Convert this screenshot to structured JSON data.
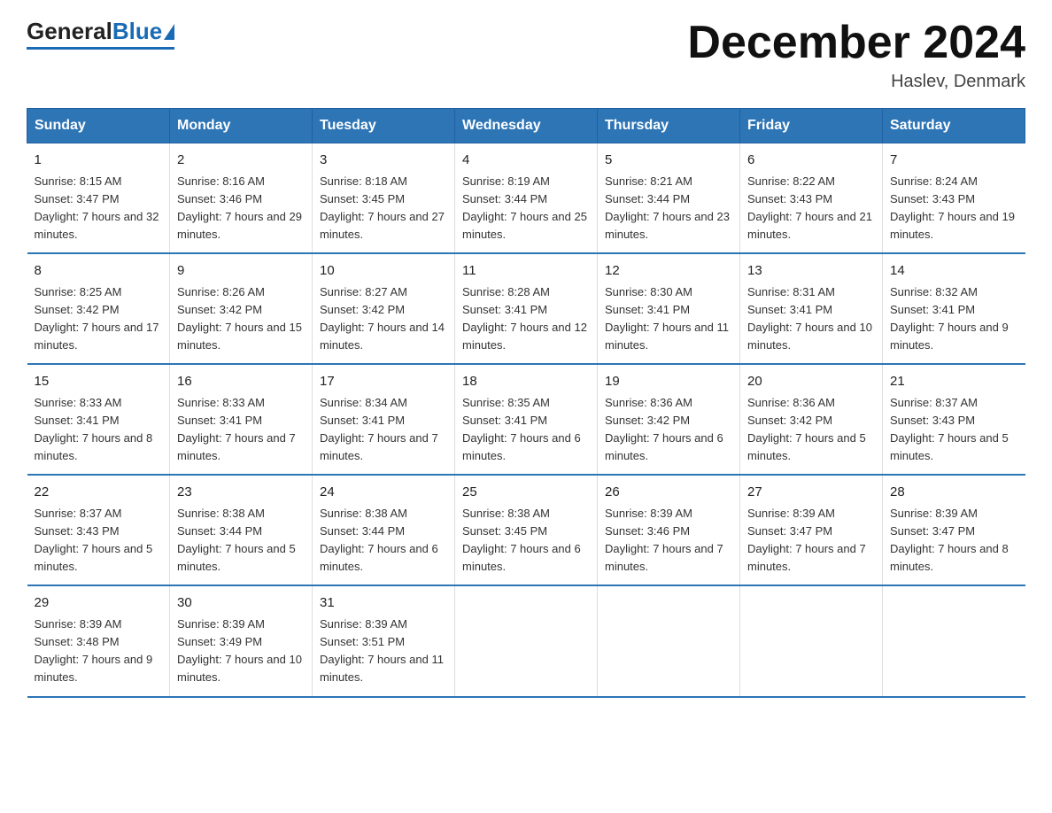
{
  "logo": {
    "general": "General",
    "blue": "Blue"
  },
  "header": {
    "month": "December 2024",
    "location": "Haslev, Denmark"
  },
  "weekdays": [
    "Sunday",
    "Monday",
    "Tuesday",
    "Wednesday",
    "Thursday",
    "Friday",
    "Saturday"
  ],
  "weeks": [
    [
      {
        "day": "1",
        "sunrise": "8:15 AM",
        "sunset": "3:47 PM",
        "daylight": "7 hours and 32 minutes."
      },
      {
        "day": "2",
        "sunrise": "8:16 AM",
        "sunset": "3:46 PM",
        "daylight": "7 hours and 29 minutes."
      },
      {
        "day": "3",
        "sunrise": "8:18 AM",
        "sunset": "3:45 PM",
        "daylight": "7 hours and 27 minutes."
      },
      {
        "day": "4",
        "sunrise": "8:19 AM",
        "sunset": "3:44 PM",
        "daylight": "7 hours and 25 minutes."
      },
      {
        "day": "5",
        "sunrise": "8:21 AM",
        "sunset": "3:44 PM",
        "daylight": "7 hours and 23 minutes."
      },
      {
        "day": "6",
        "sunrise": "8:22 AM",
        "sunset": "3:43 PM",
        "daylight": "7 hours and 21 minutes."
      },
      {
        "day": "7",
        "sunrise": "8:24 AM",
        "sunset": "3:43 PM",
        "daylight": "7 hours and 19 minutes."
      }
    ],
    [
      {
        "day": "8",
        "sunrise": "8:25 AM",
        "sunset": "3:42 PM",
        "daylight": "7 hours and 17 minutes."
      },
      {
        "day": "9",
        "sunrise": "8:26 AM",
        "sunset": "3:42 PM",
        "daylight": "7 hours and 15 minutes."
      },
      {
        "day": "10",
        "sunrise": "8:27 AM",
        "sunset": "3:42 PM",
        "daylight": "7 hours and 14 minutes."
      },
      {
        "day": "11",
        "sunrise": "8:28 AM",
        "sunset": "3:41 PM",
        "daylight": "7 hours and 12 minutes."
      },
      {
        "day": "12",
        "sunrise": "8:30 AM",
        "sunset": "3:41 PM",
        "daylight": "7 hours and 11 minutes."
      },
      {
        "day": "13",
        "sunrise": "8:31 AM",
        "sunset": "3:41 PM",
        "daylight": "7 hours and 10 minutes."
      },
      {
        "day": "14",
        "sunrise": "8:32 AM",
        "sunset": "3:41 PM",
        "daylight": "7 hours and 9 minutes."
      }
    ],
    [
      {
        "day": "15",
        "sunrise": "8:33 AM",
        "sunset": "3:41 PM",
        "daylight": "7 hours and 8 minutes."
      },
      {
        "day": "16",
        "sunrise": "8:33 AM",
        "sunset": "3:41 PM",
        "daylight": "7 hours and 7 minutes."
      },
      {
        "day": "17",
        "sunrise": "8:34 AM",
        "sunset": "3:41 PM",
        "daylight": "7 hours and 7 minutes."
      },
      {
        "day": "18",
        "sunrise": "8:35 AM",
        "sunset": "3:41 PM",
        "daylight": "7 hours and 6 minutes."
      },
      {
        "day": "19",
        "sunrise": "8:36 AM",
        "sunset": "3:42 PM",
        "daylight": "7 hours and 6 minutes."
      },
      {
        "day": "20",
        "sunrise": "8:36 AM",
        "sunset": "3:42 PM",
        "daylight": "7 hours and 5 minutes."
      },
      {
        "day": "21",
        "sunrise": "8:37 AM",
        "sunset": "3:43 PM",
        "daylight": "7 hours and 5 minutes."
      }
    ],
    [
      {
        "day": "22",
        "sunrise": "8:37 AM",
        "sunset": "3:43 PM",
        "daylight": "7 hours and 5 minutes."
      },
      {
        "day": "23",
        "sunrise": "8:38 AM",
        "sunset": "3:44 PM",
        "daylight": "7 hours and 5 minutes."
      },
      {
        "day": "24",
        "sunrise": "8:38 AM",
        "sunset": "3:44 PM",
        "daylight": "7 hours and 6 minutes."
      },
      {
        "day": "25",
        "sunrise": "8:38 AM",
        "sunset": "3:45 PM",
        "daylight": "7 hours and 6 minutes."
      },
      {
        "day": "26",
        "sunrise": "8:39 AM",
        "sunset": "3:46 PM",
        "daylight": "7 hours and 7 minutes."
      },
      {
        "day": "27",
        "sunrise": "8:39 AM",
        "sunset": "3:47 PM",
        "daylight": "7 hours and 7 minutes."
      },
      {
        "day": "28",
        "sunrise": "8:39 AM",
        "sunset": "3:47 PM",
        "daylight": "7 hours and 8 minutes."
      }
    ],
    [
      {
        "day": "29",
        "sunrise": "8:39 AM",
        "sunset": "3:48 PM",
        "daylight": "7 hours and 9 minutes."
      },
      {
        "day": "30",
        "sunrise": "8:39 AM",
        "sunset": "3:49 PM",
        "daylight": "7 hours and 10 minutes."
      },
      {
        "day": "31",
        "sunrise": "8:39 AM",
        "sunset": "3:51 PM",
        "daylight": "7 hours and 11 minutes."
      },
      {
        "day": "",
        "sunrise": "",
        "sunset": "",
        "daylight": ""
      },
      {
        "day": "",
        "sunrise": "",
        "sunset": "",
        "daylight": ""
      },
      {
        "day": "",
        "sunrise": "",
        "sunset": "",
        "daylight": ""
      },
      {
        "day": "",
        "sunrise": "",
        "sunset": "",
        "daylight": ""
      }
    ]
  ]
}
